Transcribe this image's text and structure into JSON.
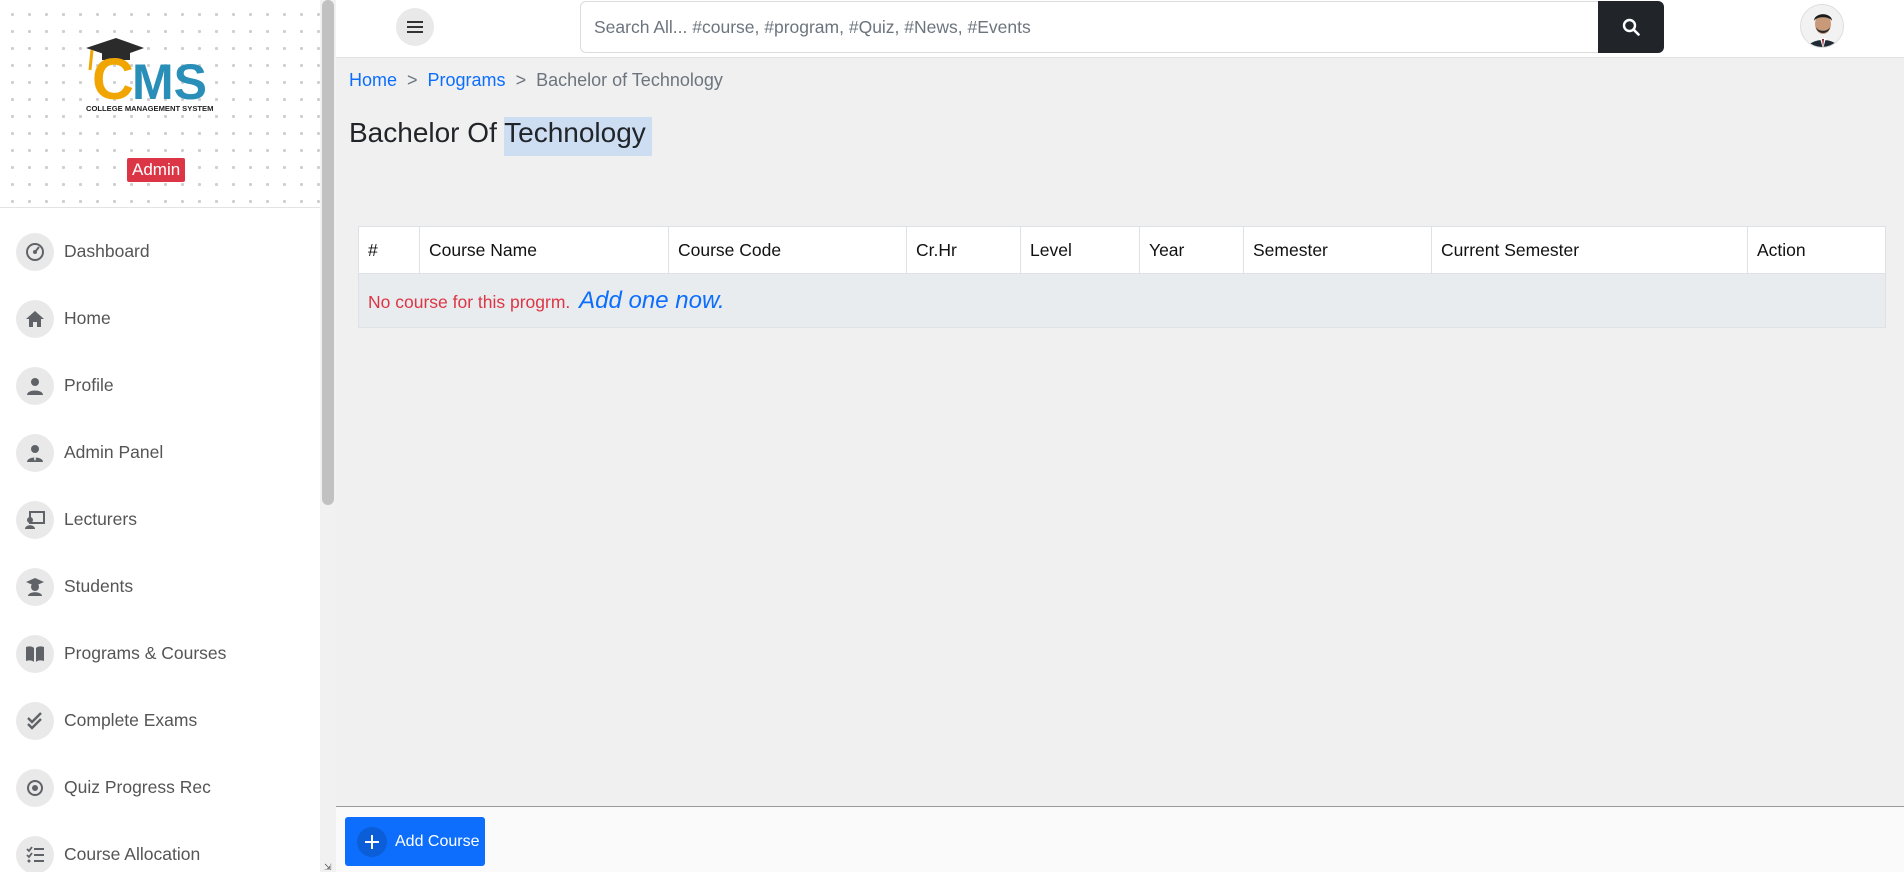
{
  "brand": {
    "logo_text": "CMS",
    "logo_subtitle": "COLLEGE MANAGEMENT SYSTEM",
    "role_badge": "Admin",
    "badge_color": "#dc3545"
  },
  "sidebar": {
    "items": [
      {
        "label": "Dashboard",
        "icon": "gauge-icon"
      },
      {
        "label": "Home",
        "icon": "home-icon"
      },
      {
        "label": "Profile",
        "icon": "user-icon"
      },
      {
        "label": "Admin Panel",
        "icon": "user-tie-icon"
      },
      {
        "label": "Lecturers",
        "icon": "chalkboard-teacher-icon"
      },
      {
        "label": "Students",
        "icon": "graduate-icon"
      },
      {
        "label": "Programs & Courses",
        "icon": "book-open-icon"
      },
      {
        "label": "Complete Exams",
        "icon": "check-double-icon"
      },
      {
        "label": "Quiz Progress Rec",
        "icon": "record-icon"
      },
      {
        "label": "Course Allocation",
        "icon": "tasks-icon"
      }
    ]
  },
  "topbar": {
    "search_placeholder": "Search All... #course, #program, #Quiz, #News, #Events",
    "search_icon": "search-icon",
    "menu_icon": "bars-icon",
    "avatar_icon": "user-avatar"
  },
  "breadcrumb": {
    "home": "Home",
    "programs": "Programs",
    "current": "Bachelor of Technology",
    "separator": ">"
  },
  "page": {
    "title_part1": "Bachelor Of",
    "title_part2": "Technology"
  },
  "table": {
    "headers": [
      "#",
      "Course Name",
      "Course Code",
      "Cr.Hr",
      "Level",
      "Year",
      "Semester",
      "Current Semester",
      "Action"
    ],
    "empty_message": "No course for this progrm.",
    "add_link": "Add one now."
  },
  "footer": {
    "add_course_label": "Add Course",
    "accent_color": "#0d6efd"
  }
}
